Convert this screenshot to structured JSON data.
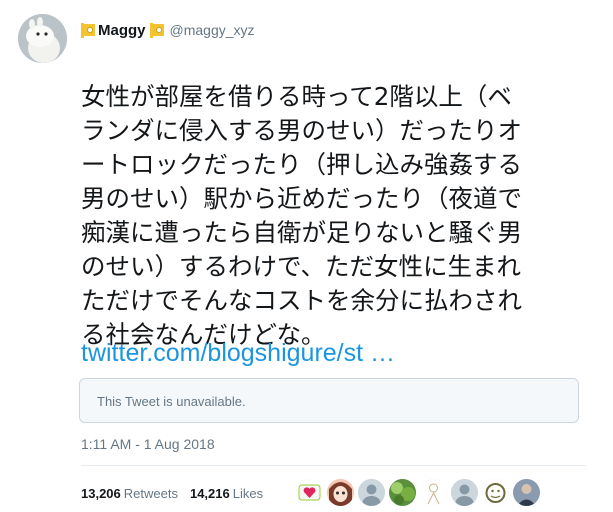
{
  "user": {
    "display_name": "Maggy",
    "username": "@maggy_xyz"
  },
  "tweet": {
    "lines": [
      "女性が部屋を借りる時って2階以上（ベ",
      "ランダに侵入する男のせい）だったりオ",
      "ートロックだったり（押し込み強姦する",
      "男のせい）駅から近めだったり（夜道で",
      "痴漢に遭ったら自衛が足りないと騒ぐ男",
      "のせい）するわけで、ただ女性に生まれ",
      "ただけでそんなコストを余分に払わされ",
      "る社会なんだけどな。"
    ],
    "link": "twitter.com/blogshigure/st …",
    "quoted_tweet": "This Tweet is unavailable.",
    "timestamp": "1:11 AM - 1 Aug 2018"
  },
  "stats": {
    "retweets_count": "13,206",
    "retweets_label": "Retweets",
    "likes_count": "14,216",
    "likes_label": "Likes"
  },
  "likers": [
    {
      "icon": "heart-badge-avatar",
      "bg": "#ffffff",
      "fg": "#e0245e"
    },
    {
      "icon": "anime-girl-avatar",
      "bg": "#f3c7b4",
      "fg": "#7a3b2a"
    },
    {
      "icon": "default-egg-avatar",
      "bg": "#ccd6dd",
      "fg": "#8899a6"
    },
    {
      "icon": "green-leaves-avatar",
      "bg": "#5a8f3c",
      "fg": "#9fcf6a"
    },
    {
      "icon": "sketch-character-avatar",
      "bg": "#ffffff",
      "fg": "#c9b48a"
    },
    {
      "icon": "default-egg-avatar",
      "bg": "#ccd6dd",
      "fg": "#8899a6"
    },
    {
      "icon": "doodle-face-avatar",
      "bg": "#ffffff",
      "fg": "#6b6b3a"
    },
    {
      "icon": "photo-person-avatar",
      "bg": "#8a9bb0",
      "fg": "#2d3a4a"
    }
  ],
  "colors": {
    "link": "#1b95e0",
    "secondary_text": "#657786",
    "border": "#ccd6dd",
    "flag_yellow": "#f4c430"
  }
}
